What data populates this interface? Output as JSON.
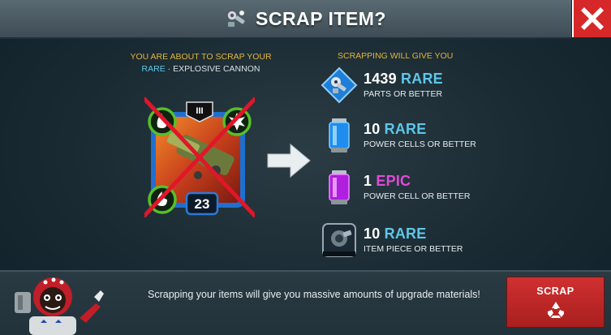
{
  "header": {
    "title": "SCRAP ITEM?",
    "title_icon": "scrap-parts-icon",
    "close_icon": "close-x-icon"
  },
  "left": {
    "line1": "YOU ARE ABOUT TO SCRAP YOUR",
    "rarity": "RARE",
    "separator": " · ",
    "item_name": "EXPLOSIVE CANNON",
    "card": {
      "level": "23",
      "tier_badge": "III",
      "crossed_out": true
    }
  },
  "right": {
    "heading": "SCRAPPING WILL GIVE YOU",
    "rewards": [
      {
        "amount": "1439",
        "rarity": "RARE",
        "description": "PARTS OR BETTER",
        "icon": "parts-icon"
      },
      {
        "amount": "10",
        "rarity": "RARE",
        "description": "POWER CELLS OR BETTER",
        "icon": "blue-power-cell-icon"
      },
      {
        "amount": "1",
        "rarity": "EPIC",
        "description": "POWER CELL OR BETTER",
        "icon": "purple-power-cell-icon"
      },
      {
        "amount": "10",
        "rarity": "RARE",
        "description": "ITEM PIECE OR BETTER",
        "icon": "item-piece-icon"
      }
    ]
  },
  "footer": {
    "message": "Scrapping your items will give you massive amounts of upgrade materials!",
    "scrap_label": "SCRAP",
    "scrap_icon": "recycle-icon"
  },
  "colors": {
    "rare": "#5ec6e8",
    "epic": "#e04bd8",
    "heading_yellow": "#e3b43c",
    "button_red": "#c62828"
  }
}
